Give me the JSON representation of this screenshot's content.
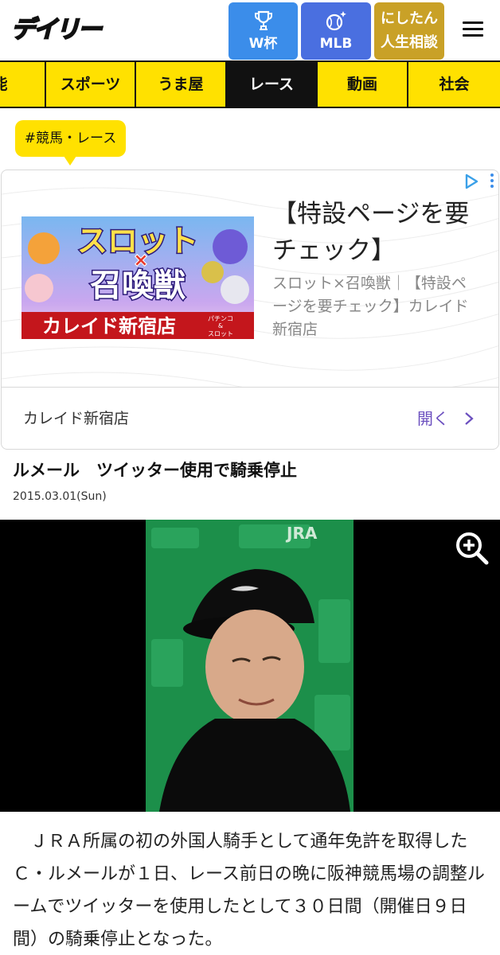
{
  "header": {
    "logo": "デイリー",
    "buttons": [
      {
        "label": "W杯",
        "icon": "trophy-icon"
      },
      {
        "label": "MLB",
        "icon": "baseball-icon"
      },
      {
        "label_line1": "にしたん",
        "label_line2": "人生相談"
      }
    ],
    "menu_icon": "hamburger-menu-icon"
  },
  "nav": {
    "items": [
      "能",
      "スポーツ",
      "うま屋",
      "レース",
      "動画",
      "社会"
    ],
    "active": "レース",
    "colors": {
      "bar": "#ffe100",
      "active_bg": "#111111"
    }
  },
  "tag": "#競馬・レース",
  "ad": {
    "banner_line1": "スロット",
    "banner_x": "×",
    "banner_line2": "召喚獣",
    "banner_store": "カレイド新宿店",
    "banner_sub1": "パチンコ",
    "banner_sub2": "&",
    "banner_sub3": "スロット",
    "title": "【特設ページを要チェック】",
    "description": "スロット×召喚獣｜【特設ページを要チェック】カレイド新宿店",
    "advertiser": "カレイド新宿店",
    "open_label": "開く"
  },
  "article": {
    "headline": "ルメール　ツイッター使用で騎乗停止",
    "date": "2015.03.01(Sun)",
    "photo_text": "JRA",
    "body": "　ＪＲＡ所属の初の外国人騎手として通年免許を取得したＣ・ルメールが１日、レース前日の晩に阪神競馬場の調整ルームでツイッターを使用したとして３０日間（開催日９日間）の騎乗停止となった。"
  }
}
